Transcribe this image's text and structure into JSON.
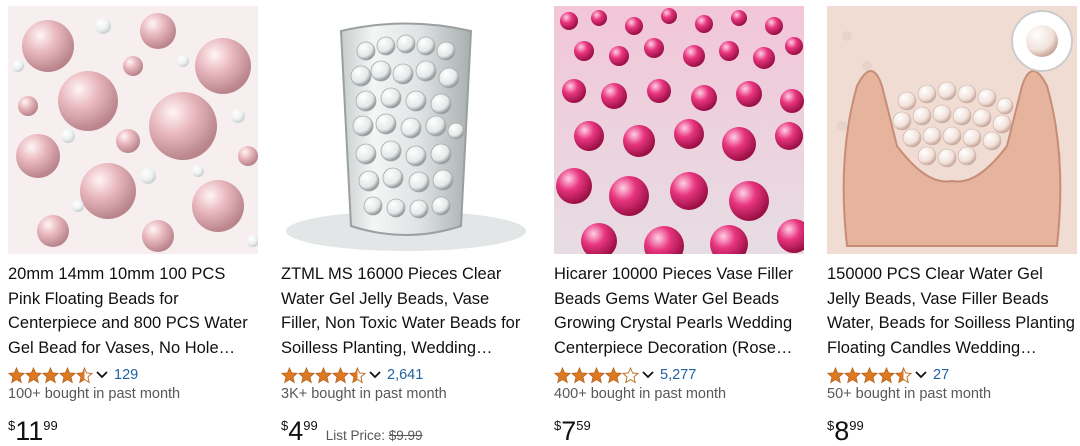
{
  "colors": {
    "star_fill": "#de7921",
    "link": "#2162a1",
    "muted_text": "#565959",
    "text": "#0f1111"
  },
  "products": [
    {
      "title": "20mm 14mm 10mm 100 PCS Pink Floating Beads for Centerpiece and 800 PCS Water Gel Bead for Vases, No Hole…",
      "rating_stars": 4.5,
      "rating_count": "129",
      "bought": "100+ bought in past month",
      "price_symbol": "$",
      "price_whole": "11",
      "price_fraction": "99",
      "image": "pink-pearl-beads"
    },
    {
      "title": "ZTML MS 16000 Pieces Clear Water Gel Jelly Beads, Vase Filler, Non Toxic Water Beads for Soilless Planting, Wedding…",
      "rating_stars": 4.5,
      "rating_count": "2,641",
      "bought": "3K+ bought in past month",
      "price_symbol": "$",
      "price_whole": "4",
      "price_fraction": "99",
      "list_price_label": "List Price:",
      "list_price_value": "$9.99",
      "image": "clear-beads-in-glass-vase"
    },
    {
      "title": "Hicarer 10000 Pieces Vase Filler Beads Gems Water Gel Beads Growing Crystal Pearls Wedding Centerpiece Decoration (Rose…",
      "rating_stars": 4,
      "rating_count": "5,277",
      "bought": "400+ bought in past month",
      "price_symbol": "$",
      "price_whole": "7",
      "price_fraction": "59",
      "image": "rose-water-gel-beads"
    },
    {
      "title": "150000 PCS Clear Water Gel Jelly Beads, Vase Filler Beads Water, Beads for Soilless Planting Floating Candles Wedding…",
      "rating_stars": 4.5,
      "rating_count": "27",
      "bought": "50+ bought in past month",
      "price_symbol": "$",
      "price_whole": "8",
      "price_fraction": "99",
      "image": "hands-holding-clear-beads"
    }
  ]
}
